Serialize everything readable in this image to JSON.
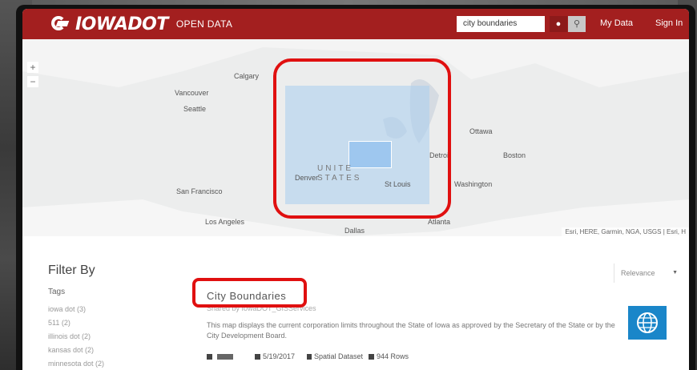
{
  "header": {
    "logo_text": "IOWADOT",
    "logo_sub": "OPEN DATA",
    "search_value": "city boundaries",
    "nav": {
      "my_data": "My Data",
      "sign_in": "Sign In"
    }
  },
  "map": {
    "zoom_in": "+",
    "zoom_out": "−",
    "labels": {
      "calgary": "Calgary",
      "vancouver": "Vancouver",
      "seattle": "Seattle",
      "ottawa": "Ottawa",
      "boston": "Boston",
      "detroit": "Detroi",
      "denver": "Denver",
      "united": "UNITE",
      "states": "STATES",
      "st_louis": "St Louis",
      "washington": "Washington",
      "san_francisco": "San Francisco",
      "los_angeles": "Los Angeles",
      "dallas": "Dallas",
      "atlanta": "Atlanta"
    },
    "attribution": "Esri, HERE, Garmin, NGA, USGS | Esri, H"
  },
  "filter": {
    "title": "Filter By",
    "tags_heading": "Tags",
    "tags": [
      "iowa dot (3)",
      "511 (2)",
      "illinois dot (2)",
      "kansas dot (2)",
      "minnesota dot (2)"
    ]
  },
  "sort": {
    "value": "Relevance"
  },
  "result": {
    "title": "City Boundaries",
    "source": "Shared by IowaDOT_GISServices",
    "description": "This map displays the current corporation limits throughout the State of Iowa as approved by the Secretary of the State or by the City Development Board.",
    "date": "5/19/2017",
    "type": "Spatial Dataset",
    "rows": "944 Rows"
  },
  "colors": {
    "brand": "#a31f1f",
    "highlight": "#e01010",
    "thumb": "#1a86c9"
  }
}
